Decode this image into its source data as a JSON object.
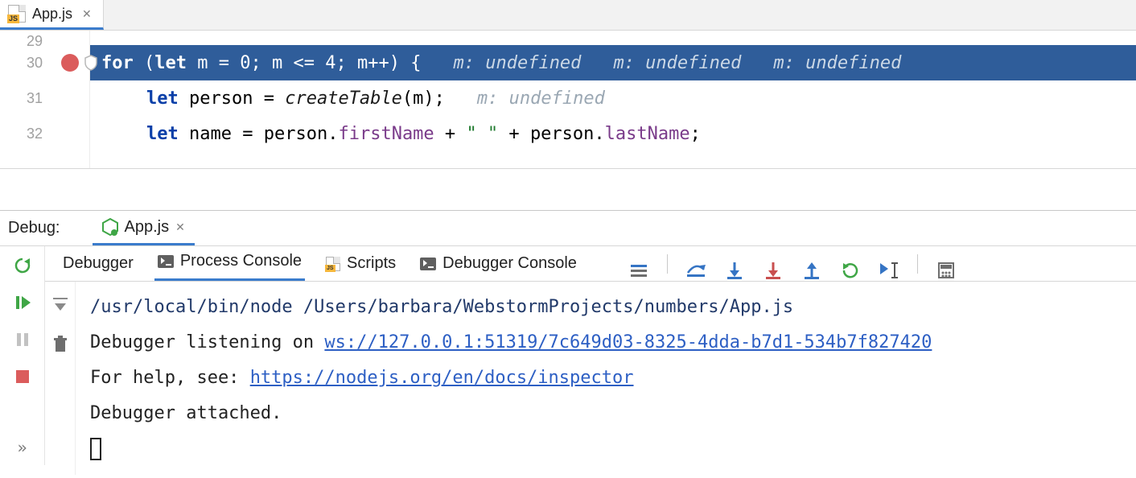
{
  "editor": {
    "tab": {
      "filename": "App.js",
      "icon_badge": "JS"
    },
    "lines": [
      {
        "num": "29"
      },
      {
        "num": "30",
        "breakpoint": true
      },
      {
        "num": "31"
      },
      {
        "num": "32"
      }
    ],
    "code": {
      "line30": {
        "kw_for": "for",
        "paren_open": " (",
        "kw_let": "let",
        "var_m": " m ",
        "eq": "= ",
        "zero": "0",
        "semi1": "; ",
        "cond": "m <= ",
        "four": "4",
        "semi2": "; ",
        "inc": "m++",
        "paren_close": ") {",
        "inlay": "m: undefined",
        "inlay2": "m: undefined",
        "inlay3": "m: undefined"
      },
      "line31": {
        "kw_let": "let",
        "var": " person ",
        "eq": "= ",
        "fn": "createTable",
        "args": "(m);",
        "inlay": "m: undefined"
      },
      "line32": {
        "kw_let": "let",
        "var": " name ",
        "eq": "= ",
        "obj1": "person",
        "dot1": ".",
        "prop1": "firstName",
        "plus1": " + ",
        "str": "\" \"",
        "plus2": " + ",
        "obj2": "person",
        "dot2": ".",
        "prop2": "lastName",
        "semi": ";"
      }
    }
  },
  "debug": {
    "title": "Debug:",
    "run_config": "App.js",
    "tabs": {
      "debugger": "Debugger",
      "process_console": "Process Console",
      "scripts": "Scripts",
      "debugger_console": "Debugger Console"
    }
  },
  "console": {
    "cmd": "/usr/local/bin/node /Users/barbara/WebstormProjects/numbers/App.js",
    "line2_pre": "Debugger listening on ",
    "line2_url": "ws://127.0.0.1:51319/7c649d03-8325-4dda-b7d1-534b7f827420",
    "line3_pre": "For help, see: ",
    "line3_url": "https://nodejs.org/en/docs/inspector",
    "line4": "Debugger attached."
  },
  "icons": {
    "stack_trace": "stack-trace-icon",
    "step_over": "step-over-icon",
    "step_into": "step-into-icon",
    "force_step_into": "force-step-into-icon",
    "step_out": "step-out-icon",
    "run_to_cursor": "run-to-cursor-icon",
    "evaluate": "evaluate-icon",
    "calculator": "calculator-icon"
  }
}
